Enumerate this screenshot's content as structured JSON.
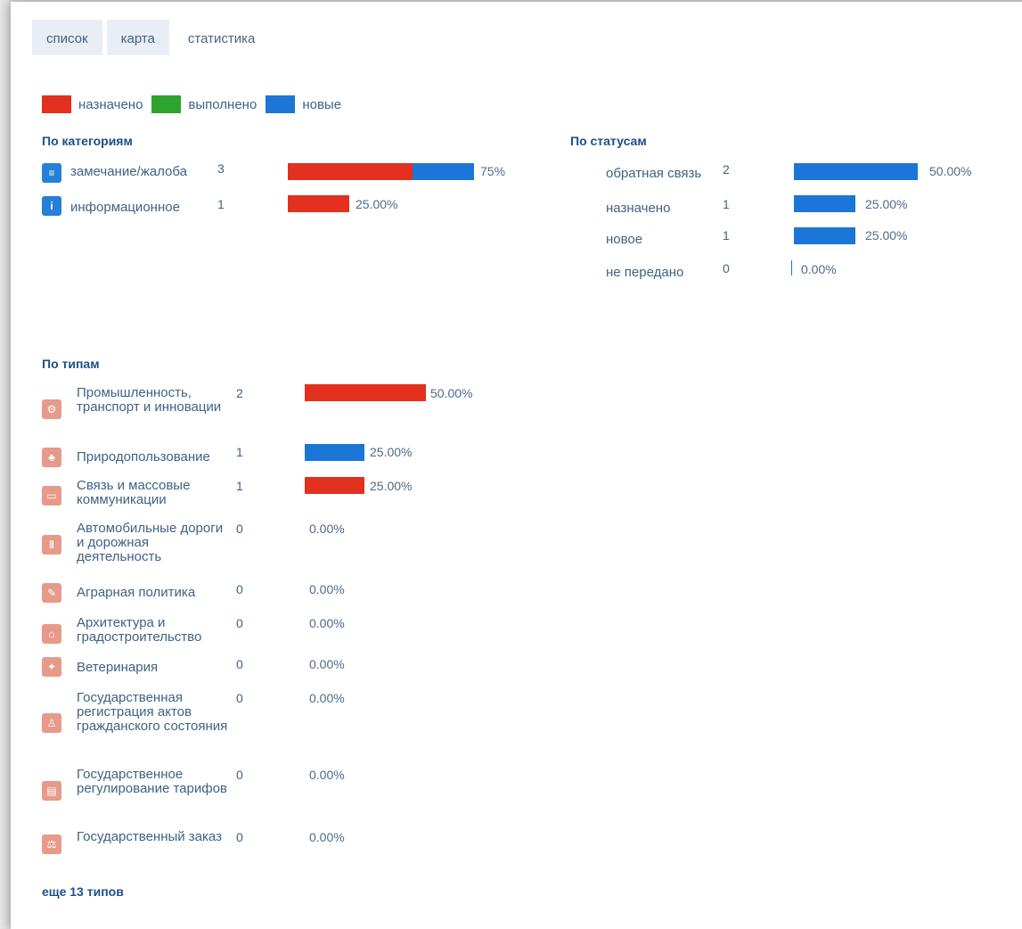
{
  "tabs": [
    "список",
    "карта",
    "статистика"
  ],
  "legend": [
    {
      "label": "назначено",
      "color": "#e3301f"
    },
    {
      "label": "выполнено",
      "color": "#2ea32e"
    },
    {
      "label": "новые",
      "color": "#1b76d8"
    }
  ],
  "categories": {
    "title": "По категориям",
    "items": [
      {
        "name": "замечание/жалоба",
        "count": "3",
        "pct": "75%",
        "segments": [
          {
            "color": "red",
            "share": 0.5
          },
          {
            "color": "blue",
            "share": 0.25
          }
        ],
        "icon": "comment-icon"
      },
      {
        "name": "информационное",
        "count": "1",
        "pct": "25.00%",
        "segments": [
          {
            "color": "red",
            "share": 0.25
          }
        ],
        "icon": "info-icon"
      }
    ]
  },
  "statuses": {
    "title": "По статусам",
    "items": [
      {
        "name": "обратная связь",
        "count": "2",
        "pct": "50.00%",
        "share": 0.5
      },
      {
        "name": "назначено",
        "count": "1",
        "pct": "25.00%",
        "share": 0.25
      },
      {
        "name": "новое",
        "count": "1",
        "pct": "25.00%",
        "share": 0.25
      },
      {
        "name": "не передано",
        "count": "0",
        "pct": "0.00%",
        "share": 0
      }
    ]
  },
  "types": {
    "title": "По типам",
    "items": [
      {
        "name": "Промышленность, транспорт и инновации",
        "count": "2",
        "pct": "50.00%",
        "share": 0.5,
        "color": "red",
        "icon": "industry-icon"
      },
      {
        "name": "Природопользование",
        "count": "1",
        "pct": "25.00%",
        "share": 0.25,
        "color": "blue",
        "icon": "nature-icon"
      },
      {
        "name": "Связь и массовые коммуникации",
        "count": "1",
        "pct": "25.00%",
        "share": 0.25,
        "color": "red",
        "icon": "tv-icon"
      },
      {
        "name": "Автомобильные дороги и дорожная деятельность",
        "count": "0",
        "pct": "0.00%",
        "share": 0,
        "color": "red",
        "icon": "road-icon"
      },
      {
        "name": "Аграрная политика",
        "count": "0",
        "pct": "0.00%",
        "share": 0,
        "color": "red",
        "icon": "agriculture-icon"
      },
      {
        "name": "Архитектура и градостроительство",
        "count": "0",
        "pct": "0.00%",
        "share": 0,
        "color": "red",
        "icon": "architecture-icon"
      },
      {
        "name": "Ветеринария",
        "count": "0",
        "pct": "0.00%",
        "share": 0,
        "color": "red",
        "icon": "veterinary-icon"
      },
      {
        "name": "Государственная регистрация актов гражданского состояния",
        "count": "0",
        "pct": "0.00%",
        "share": 0,
        "color": "red",
        "icon": "registry-icon"
      },
      {
        "name": "Государственное регулирование тарифов",
        "count": "0",
        "pct": "0.00%",
        "share": 0,
        "color": "red",
        "icon": "tariff-icon"
      },
      {
        "name": "Государственный заказ",
        "count": "0",
        "pct": "0.00%",
        "share": 0,
        "color": "red",
        "icon": "order-icon"
      }
    ],
    "more": "еще 13 типов"
  },
  "colors": {
    "red": "#e3301f",
    "blue": "#1b76d8",
    "green": "#2ea32e"
  }
}
